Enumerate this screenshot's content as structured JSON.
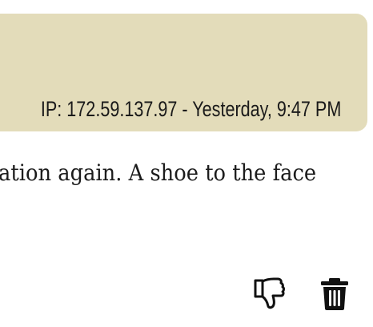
{
  "previous_message": {
    "meta": "IP: 172.59.137.97 - Yesterday, 9:47 PM"
  },
  "message": {
    "text": "ation again. A shoe to the face"
  },
  "actions": {
    "dislike_icon": "thumbs-down-icon",
    "delete_icon": "trash-icon"
  },
  "colors": {
    "bubble": "#e3dcba",
    "text": "#1c1c1c"
  }
}
